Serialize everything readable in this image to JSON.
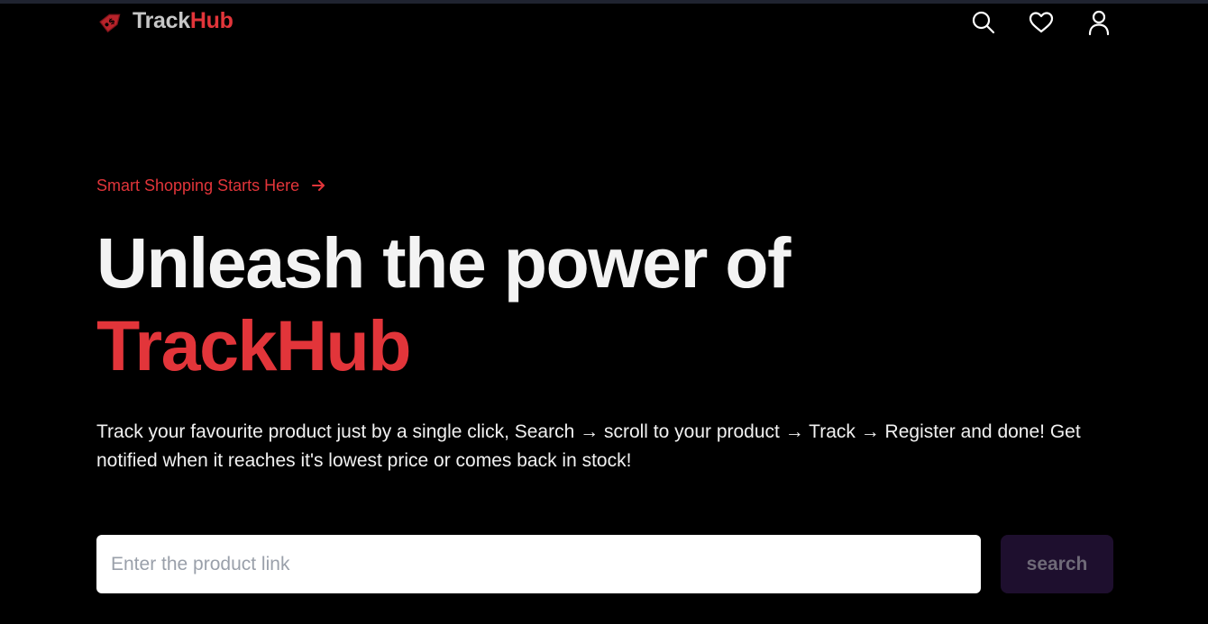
{
  "header": {
    "logo": {
      "icon": "price-tag-icon",
      "text_part1": "Track",
      "text_part2": "Hub"
    },
    "nav_icons": [
      "search-icon",
      "heart-icon",
      "user-icon"
    ]
  },
  "hero": {
    "tagline": "Smart Shopping Starts Here",
    "tagline_icon": "arrow-right-icon",
    "headline_line1": "Unleash the power of",
    "headline_brand": "TrackHub",
    "description": "Track your favourite product just by a single click, Search → scroll to your product → Track → Register and done! Get notified when it reaches it's lowest price or comes back in stock!"
  },
  "search": {
    "placeholder": "Enter the product link",
    "value": "",
    "button_label": "search"
  },
  "colors": {
    "background": "#000000",
    "accent": "#e2353a",
    "heading": "#f3f3f3",
    "button_bg": "#1e0f2e",
    "button_text": "#6f6a78"
  }
}
